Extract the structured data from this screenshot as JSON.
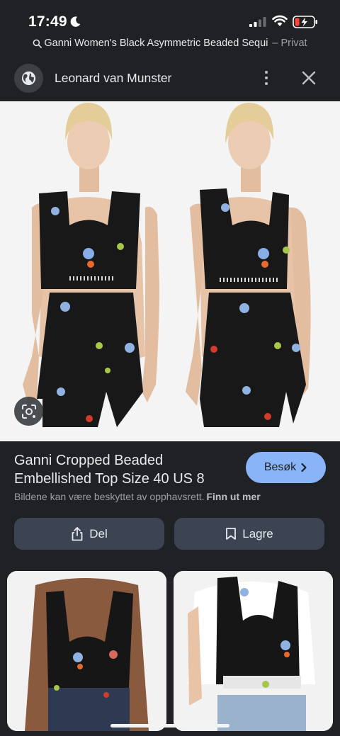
{
  "status_bar": {
    "time": "17:49",
    "icons": [
      "moon-icon",
      "signal-icon",
      "wifi-icon",
      "battery-low-charging-icon"
    ]
  },
  "url_bar": {
    "icon": "search-icon",
    "text": "Ganni Women's Black Asymmetric Beaded Sequi",
    "suffix": "– Privat"
  },
  "header": {
    "site_icon": "globe-icon",
    "site_name": "Leonard van Munster",
    "more_icon": "more-vert-icon",
    "close_icon": "close-icon"
  },
  "main_image": {
    "lens_icon": "lens-icon",
    "colors": {
      "background": "#f4f4f4",
      "garment": "#181818",
      "skin": "#e8c4a8",
      "hair": "#e6cf9a"
    }
  },
  "product": {
    "title": "Ganni Cropped Beaded Embellished Top Size 40 US 8",
    "visit_label": "Besøk",
    "copyright_text": "Bildene kan være beskyttet av opphavsrett.",
    "learn_more_label": "Finn ut mer"
  },
  "actions": {
    "share_label": "Del",
    "save_label": "Lagre"
  },
  "related_images": [
    {
      "name": "related-image-1"
    },
    {
      "name": "related-image-2"
    }
  ],
  "theme": {
    "background": "#202124",
    "accent": "#8ab4f8",
    "button_bg": "#3c4454"
  }
}
